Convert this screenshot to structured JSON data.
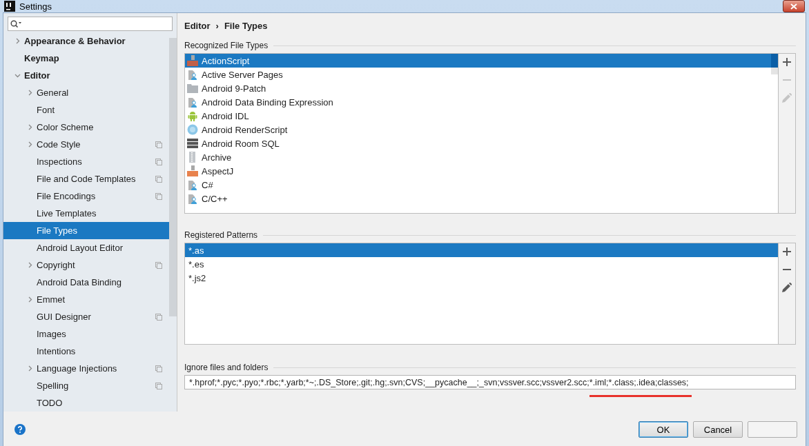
{
  "window": {
    "title": "Settings"
  },
  "sidebar": {
    "items": [
      {
        "label": "Appearance & Behavior",
        "bold": true,
        "expanded": false
      },
      {
        "label": "Keymap",
        "bold": true
      },
      {
        "label": "Editor",
        "bold": true,
        "expanded": true,
        "children": [
          {
            "label": "General",
            "expanded": false,
            "project_icon": false,
            "selected": false
          },
          {
            "label": "Font",
            "project_icon": false,
            "selected": false
          },
          {
            "label": "Color Scheme",
            "expanded": false,
            "project_icon": false,
            "selected": false
          },
          {
            "label": "Code Style",
            "expanded": false,
            "project_icon": true,
            "selected": false
          },
          {
            "label": "Inspections",
            "project_icon": true,
            "selected": false
          },
          {
            "label": "File and Code Templates",
            "project_icon": true,
            "selected": false
          },
          {
            "label": "File Encodings",
            "project_icon": true,
            "selected": false
          },
          {
            "label": "Live Templates",
            "project_icon": false,
            "selected": false
          },
          {
            "label": "File Types",
            "project_icon": false,
            "selected": true
          },
          {
            "label": "Android Layout Editor",
            "project_icon": false,
            "selected": false
          },
          {
            "label": "Copyright",
            "expanded": false,
            "project_icon": true,
            "selected": false
          },
          {
            "label": "Android Data Binding",
            "project_icon": false,
            "selected": false
          },
          {
            "label": "Emmet",
            "expanded": false,
            "project_icon": false,
            "selected": false
          },
          {
            "label": "GUI Designer",
            "project_icon": true,
            "selected": false
          },
          {
            "label": "Images",
            "project_icon": false,
            "selected": false
          },
          {
            "label": "Intentions",
            "project_icon": false,
            "selected": false
          },
          {
            "label": "Language Injections",
            "expanded": false,
            "project_icon": true,
            "selected": false
          },
          {
            "label": "Spelling",
            "project_icon": true,
            "selected": false
          },
          {
            "label": "TODO",
            "project_icon": false,
            "selected": false
          }
        ]
      }
    ]
  },
  "breadcrumb": [
    "Editor",
    "›",
    "File Types"
  ],
  "recognized": {
    "title": "Recognized File Types",
    "items": [
      {
        "label": "ActionScript",
        "kind": "as",
        "selected": true
      },
      {
        "label": "Active Server Pages",
        "kind": "generic",
        "selected": false
      },
      {
        "label": "Android 9-Patch",
        "kind": "folder",
        "selected": false
      },
      {
        "label": "Android Data Binding Expression",
        "kind": "generic",
        "selected": false
      },
      {
        "label": "Android IDL",
        "kind": "android",
        "selected": false
      },
      {
        "label": "Android RenderScript",
        "kind": "rs",
        "selected": false
      },
      {
        "label": "Android Room SQL",
        "kind": "db",
        "selected": false
      },
      {
        "label": "Archive",
        "kind": "archive",
        "selected": false
      },
      {
        "label": "AspectJ",
        "kind": "aj",
        "selected": false
      },
      {
        "label": "C#",
        "kind": "generic",
        "selected": false
      },
      {
        "label": "C/C++",
        "kind": "generic",
        "selected": false
      }
    ],
    "tools": [
      {
        "kind": "add",
        "disabled": false
      },
      {
        "kind": "remove",
        "disabled": true
      },
      {
        "kind": "edit",
        "disabled": true
      }
    ]
  },
  "patterns": {
    "title": "Registered Patterns",
    "items": [
      {
        "label": "*.as",
        "selected": true
      },
      {
        "label": "*.es",
        "selected": false
      },
      {
        "label": "*.js2",
        "selected": false
      }
    ],
    "tools": [
      {
        "kind": "add",
        "disabled": false
      },
      {
        "kind": "remove",
        "disabled": false
      },
      {
        "kind": "edit",
        "disabled": false
      }
    ]
  },
  "ignore": {
    "title": "Ignore files and folders",
    "value": [
      {
        "text": "*.hprof;*.pyc;*.pyo;*.rbc;*.yarb;*~;.DS_Store;.git;.hg;.svn;CVS;__pycache__;_svn;vssver.scc;vssver2.scc;",
        "underlined": false
      },
      {
        "text": "*.iml;*.class;.idea;classes;",
        "underlined": true
      }
    ]
  },
  "buttons": [
    {
      "label": "OK",
      "default": true,
      "disabled": false
    },
    {
      "label": "Cancel",
      "default": false,
      "disabled": false
    },
    {
      "default": false,
      "disabled": true
    }
  ]
}
